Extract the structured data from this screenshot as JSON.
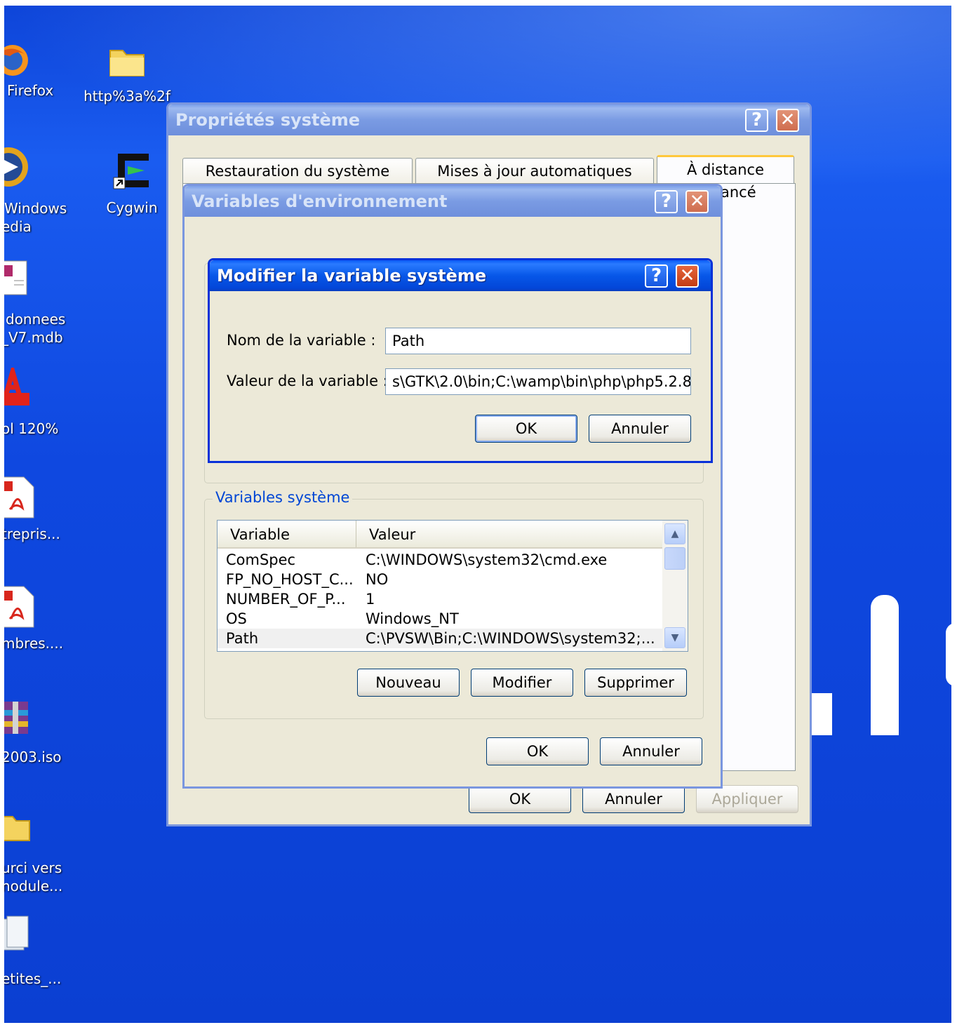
{
  "desktop": {
    "icons": [
      {
        "label": "Firefox",
        "icon": "firefox-icon"
      },
      {
        "label": "http%3a%2f",
        "icon": "folder-icon"
      },
      {
        "label": "Windows",
        "label2": "edia",
        "icon": "media-player-icon"
      },
      {
        "label": "Cygwin",
        "icon": "cygwin-icon"
      },
      {
        "label": "donnees",
        "label2": "_V7.mdb",
        "icon": "access-file-icon"
      },
      {
        "label": "ol 120%",
        "icon": "acrobat-icon"
      },
      {
        "label": "trepris...",
        "icon": "pdf-file-icon"
      },
      {
        "label": "mbres....",
        "icon": "pdf-file-icon"
      },
      {
        "label": "2003.iso",
        "icon": "winrar-icon"
      },
      {
        "label": "urci vers",
        "label2": "nodule...",
        "icon": "folder-shortcut-icon"
      },
      {
        "label": "etites_...",
        "icon": "document-icon"
      }
    ]
  },
  "system_properties": {
    "title": "Propriétés système",
    "tabs": [
      "Restauration du système",
      "Mises à jour automatiques",
      "À distance"
    ],
    "partial_tab_text": "ancé",
    "ok": "OK",
    "cancel": "Annuler",
    "apply": "Appliquer"
  },
  "env_vars": {
    "title": "Variables d'environnement",
    "system_group": "Variables système",
    "columns": [
      "Variable",
      "Valeur"
    ],
    "rows": [
      {
        "name": "ComSpec",
        "value": "C:\\WINDOWS\\system32\\cmd.exe"
      },
      {
        "name": "FP_NO_HOST_C...",
        "value": "NO"
      },
      {
        "name": "NUMBER_OF_P...",
        "value": "1"
      },
      {
        "name": "OS",
        "value": "Windows_NT"
      },
      {
        "name": "Path",
        "value": "C:\\PVSW\\Bin;C:\\WINDOWS\\system32;..."
      }
    ],
    "new": "Nouveau",
    "edit": "Modifier",
    "delete": "Supprimer",
    "ok": "OK",
    "cancel": "Annuler"
  },
  "edit_dialog": {
    "title": "Modifier la variable système",
    "name_label": "Nom de la variable :",
    "name_value": "Path",
    "value_label": "Valeur de la variable :",
    "value_value": "s\\GTK\\2.0\\bin;C:\\wamp\\bin\\php\\php5.2.8",
    "ok": "OK",
    "cancel": "Annuler"
  },
  "colors": {
    "xp_blue": "#0831d9",
    "desktop": "#0e45d9",
    "group_title": "#0046d5"
  }
}
